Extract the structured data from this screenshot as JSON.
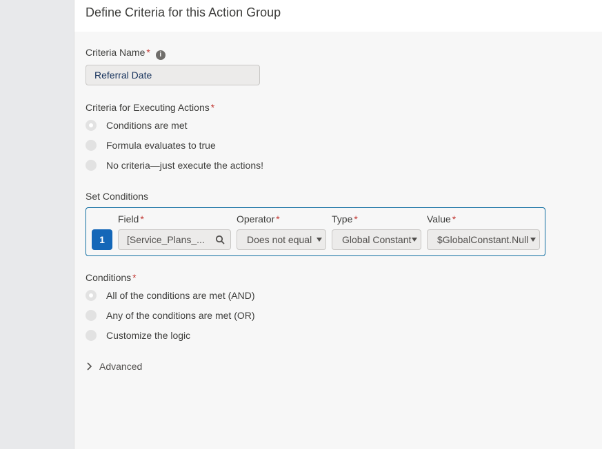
{
  "header": {
    "title": "Define Criteria for this Action Group"
  },
  "criteria_name": {
    "label": "Criteria Name",
    "required_mark": "*",
    "value": "Referral Date",
    "info_icon": "info-icon"
  },
  "execution": {
    "label": "Criteria for Executing Actions",
    "required_mark": "*",
    "options": [
      {
        "label": "Conditions are met",
        "checked": true
      },
      {
        "label": "Formula evaluates to true",
        "checked": false
      },
      {
        "label": "No criteria—just execute the actions!",
        "checked": false
      }
    ]
  },
  "set_conditions": {
    "label": "Set Conditions",
    "row_number": "1",
    "columns": {
      "field": {
        "label": "Field",
        "required_mark": "*",
        "value": "[Service_Plans_...",
        "icon": "search-icon"
      },
      "operator": {
        "label": "Operator",
        "required_mark": "*",
        "value": "Does not equal"
      },
      "type": {
        "label": "Type",
        "required_mark": "*",
        "value": "Global Constant"
      },
      "value": {
        "label": "Value",
        "required_mark": "*",
        "value": "$GlobalConstant.Null"
      }
    }
  },
  "conditions": {
    "label": "Conditions",
    "required_mark": "*",
    "options": [
      {
        "label": "All of the conditions are met (AND)",
        "checked": true
      },
      {
        "label": "Any of the conditions are met (OR)",
        "checked": false
      },
      {
        "label": "Customize the logic",
        "checked": false
      }
    ]
  },
  "advanced": {
    "label": "Advanced",
    "icon": "chevron-right-icon"
  }
}
